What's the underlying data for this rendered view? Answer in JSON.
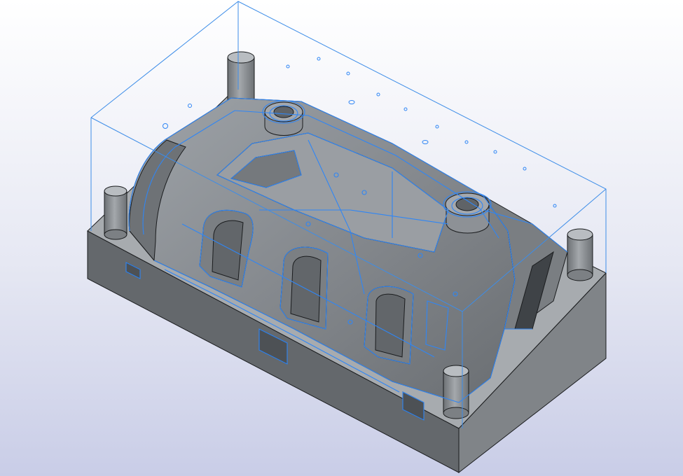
{
  "viewport": {
    "background_top": "#ffffff",
    "background_bottom": "#c9cde7",
    "model_face_light": "#b4b8bc",
    "model_face_mid": "#8a8e92",
    "model_face_dark": "#5d6165",
    "edge_color": "#1a1c1e",
    "highlight_color": "#2f86f5",
    "bounding_box_color": "#3d8de8"
  },
  "model": {
    "name_icon": "mold-core-block",
    "guide_pins": 4,
    "bosses": 2,
    "window_recesses": 3
  }
}
